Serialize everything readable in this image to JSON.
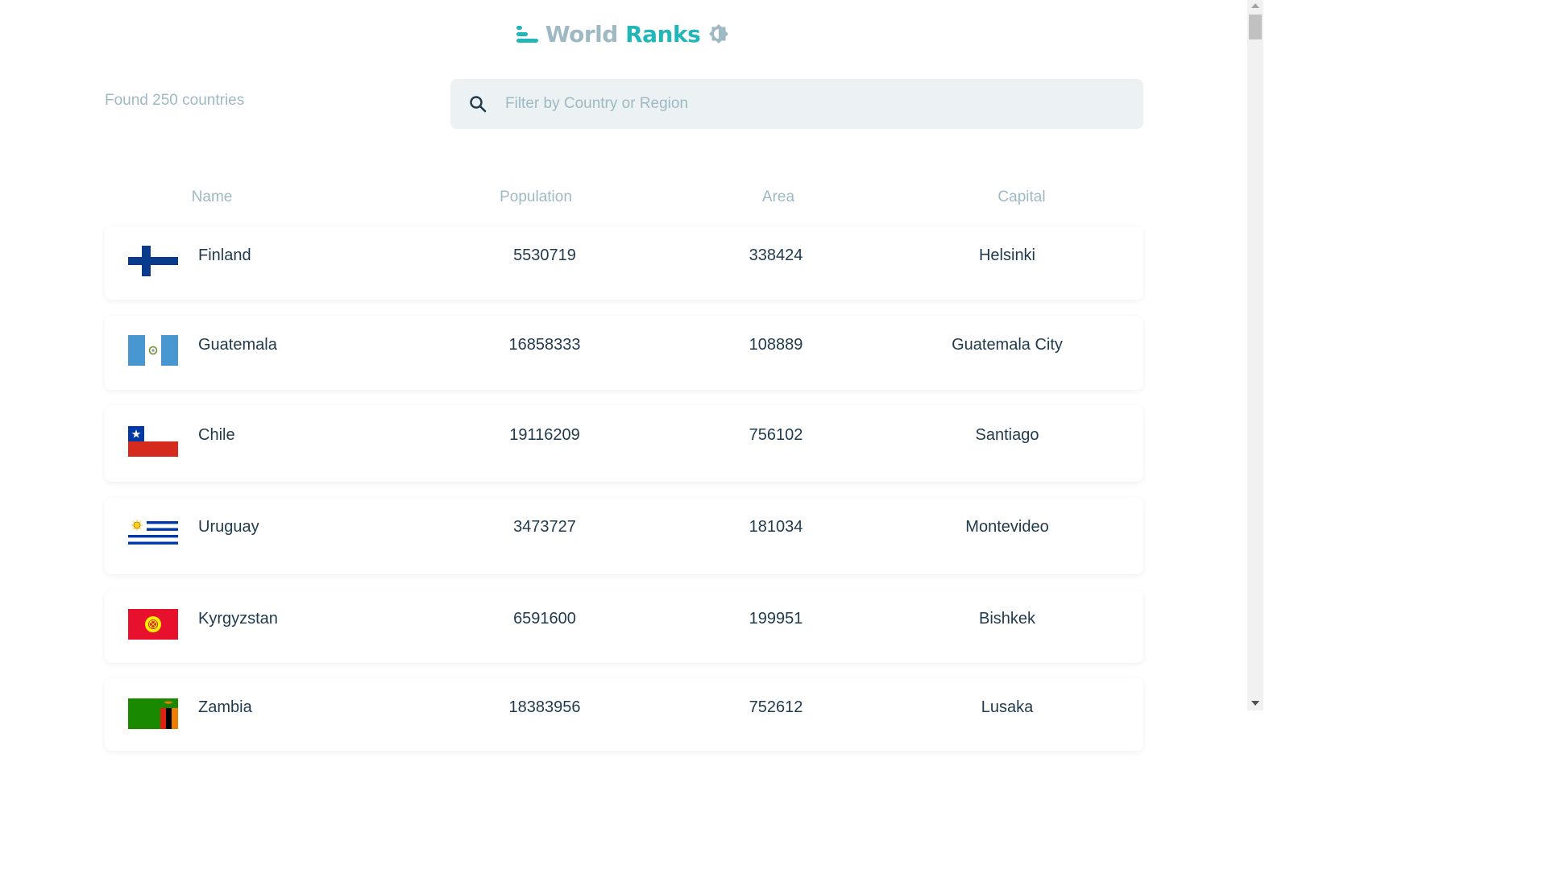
{
  "app": {
    "logo_world": "World",
    "logo_ranks": "Ranks",
    "logo_icon": "bars-icon",
    "theme_icon": "brightness-icon",
    "accent": "#21b6b7",
    "muted": "#9eb9c3"
  },
  "summary": {
    "found_text": "Found 250 countries"
  },
  "search": {
    "placeholder": "Filter by Country or Region",
    "value": "",
    "icon": "search-icon"
  },
  "table": {
    "columns": [
      "Name",
      "Population",
      "Area",
      "Capital"
    ],
    "rows": [
      {
        "name": "Finland",
        "population": "5530719",
        "area": "338424",
        "capital": "Helsinki",
        "flag": "finland-flag"
      },
      {
        "name": "Guatemala",
        "population": "16858333",
        "area": "108889",
        "capital": "Guatemala City",
        "flag": "guatemala-flag"
      },
      {
        "name": "Chile",
        "population": "19116209",
        "area": "756102",
        "capital": "Santiago",
        "flag": "chile-flag"
      },
      {
        "name": "Uruguay",
        "population": "3473727",
        "area": "181034",
        "capital": "Montevideo",
        "flag": "uruguay-flag"
      },
      {
        "name": "Kyrgyzstan",
        "population": "6591600",
        "area": "199951",
        "capital": "Bishkek",
        "flag": "kyrgyzstan-flag"
      },
      {
        "name": "Zambia",
        "population": "18383956",
        "area": "752612",
        "capital": "Lusaka",
        "flag": "zambia-flag"
      }
    ]
  }
}
